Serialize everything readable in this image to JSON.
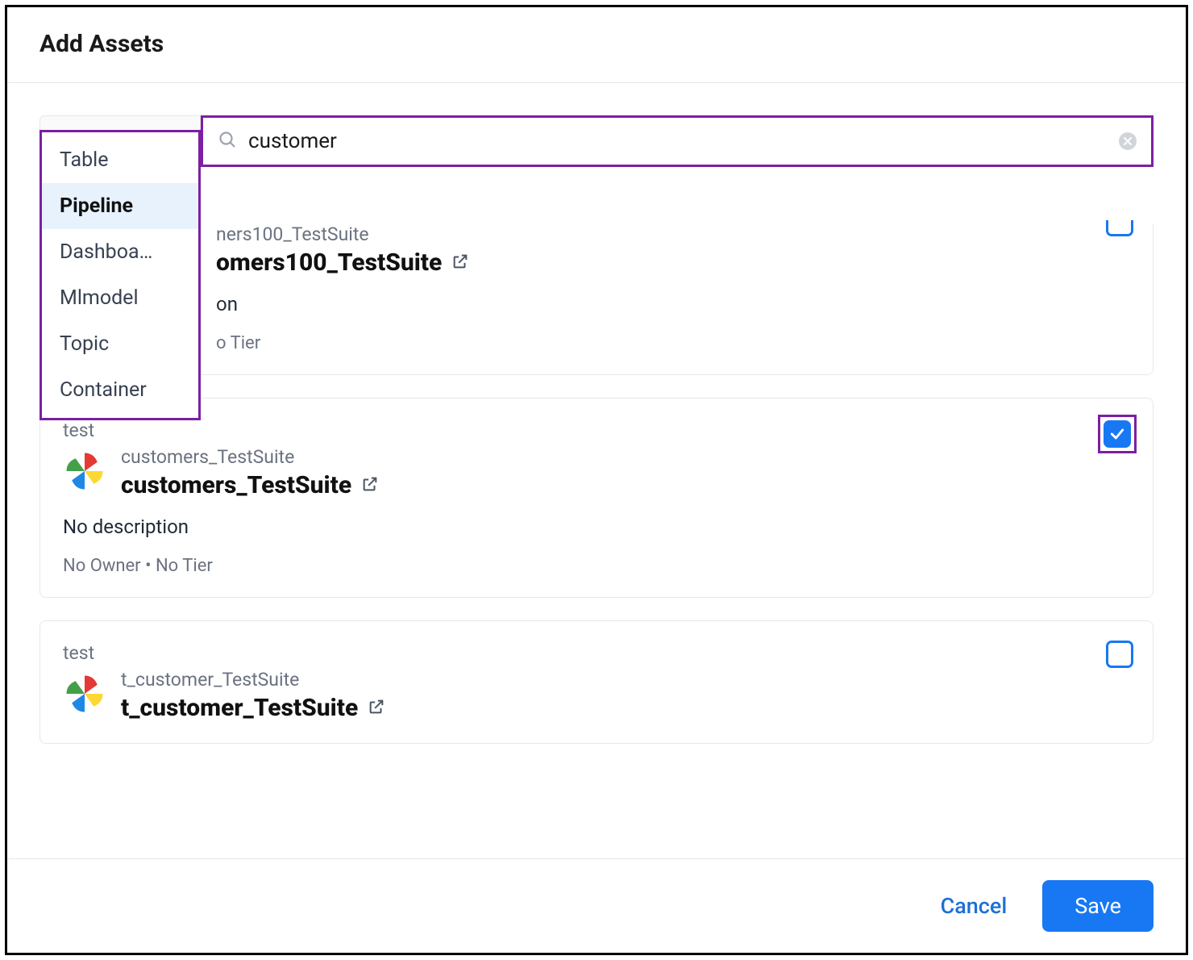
{
  "header": {
    "title": "Add Assets"
  },
  "search": {
    "value": "customer"
  },
  "dropdown": {
    "items": [
      {
        "label": "Table",
        "active": false
      },
      {
        "label": "Pipeline",
        "active": true
      },
      {
        "label": "Dashboa…",
        "active": false
      },
      {
        "label": "Mlmodel",
        "active": false
      },
      {
        "label": "Topic",
        "active": false
      },
      {
        "label": "Container",
        "active": false
      }
    ]
  },
  "results": [
    {
      "breadcrumb_suffix": "ners100_TestSuite",
      "title_suffix": "omers100_TestSuite",
      "description": "on",
      "tier": "o Tier",
      "checked": false,
      "highlighted": false
    },
    {
      "breadcrumb": "test",
      "subtitle": "customers_TestSuite",
      "title": "customers_TestSuite",
      "description": "No description",
      "owner": "No Owner",
      "tier": "No Tier",
      "checked": true,
      "highlighted": true
    },
    {
      "breadcrumb": "test",
      "subtitle": "t_customer_TestSuite",
      "title": "t_customer_TestSuite",
      "checked": false,
      "highlighted": false
    }
  ],
  "footer": {
    "cancel": "Cancel",
    "save": "Save"
  },
  "meta_separator": "  •  "
}
